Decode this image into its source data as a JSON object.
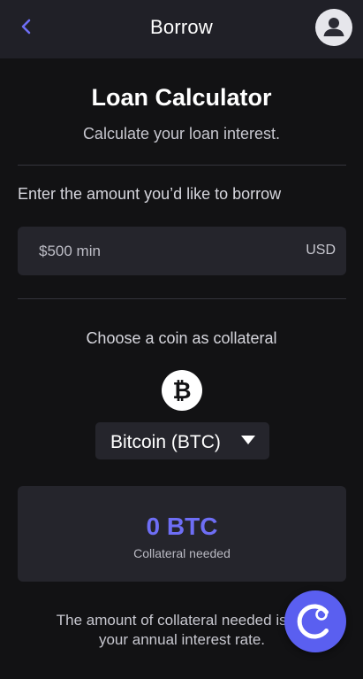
{
  "header": {
    "title": "Borrow",
    "back_icon": "chevron-left-icon",
    "avatar_icon": "user-avatar-icon"
  },
  "calculator": {
    "title": "Loan Calculator",
    "subtitle": "Calculate your loan interest."
  },
  "borrow": {
    "label": "Enter the amount you’d like to borrow",
    "placeholder": "$500 min",
    "value": "",
    "currency": "USD"
  },
  "collateral": {
    "label": "Choose a coin as collateral",
    "coin_icon": "bitcoin-icon",
    "selected_coin": "Bitcoin (BTC)",
    "dropdown_icon": "caret-down-icon"
  },
  "result": {
    "value": "0 BTC",
    "caption": "Collateral needed"
  },
  "note": {
    "line1": "The amount of collateral needed is ba",
    "line2": "your annual interest rate."
  },
  "fab": {
    "icon": "celsius-logo-icon"
  },
  "colors": {
    "background": "#121214",
    "header": "#202027",
    "card": "#25252c",
    "accent": "#6e6ef5",
    "fab": "#5a5ff0"
  }
}
